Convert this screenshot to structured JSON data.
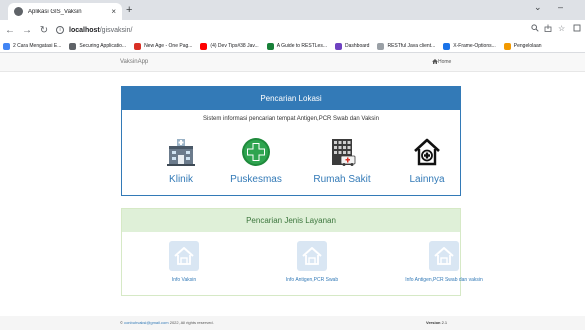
{
  "browser": {
    "tab_title": "Aplikasi GIS_Vaksin",
    "tab_close": "×",
    "new_tab": "+",
    "url_host": "localhost",
    "url_path": "/gisvaksin/",
    "bookmarks": [
      {
        "label": "2 Cara Mengatasi E...",
        "color": "#4285f4"
      },
      {
        "label": "Securing Applicatio...",
        "color": "#5f6368"
      },
      {
        "label": "New Age - One Pag...",
        "color": "#d93025"
      },
      {
        "label": "(4) Dev Tips#38 Jav...",
        "color": "#ff0000"
      },
      {
        "label": "A Guide to RESTLes...",
        "color": "#188038"
      },
      {
        "label": "Dashboard",
        "color": "#6f42c1"
      },
      {
        "label": "RESTful Java client...",
        "color": "#9aa0a6"
      },
      {
        "label": "X-Frame-Options...",
        "color": "#1a73e8"
      },
      {
        "label": "Pengelolaan",
        "color": "#f29900"
      }
    ]
  },
  "nav": {
    "brand": "VaksinApp",
    "home": "Home"
  },
  "lokasi": {
    "heading": "Pencarian Lokasi",
    "subtitle": "Sistem informasi pencarian tempat Antigen,PCR Swab dan Vaksin",
    "items": [
      {
        "label": "Klinik",
        "icon": "hospital-building-icon"
      },
      {
        "label": "Puskesmas",
        "icon": "medical-cross-icon"
      },
      {
        "label": "Rumah Sakit",
        "icon": "hospital-ambulance-icon"
      },
      {
        "label": "Lainnya",
        "icon": "house-medical-icon"
      }
    ]
  },
  "layanan": {
    "heading": "Pencarian Jenis Layanan",
    "items": [
      {
        "label": "Info Vaksin",
        "icon": "home-icon"
      },
      {
        "label": "Info Antigen,PCR Swab",
        "icon": "home-icon"
      },
      {
        "label": "Info Antigen,PCR Swab dan vaksin",
        "icon": "home-icon"
      }
    ]
  },
  "footer": {
    "copyright_prefix": "©",
    "email": "conbuhvaksi@gmail.com",
    "copyright_suffix": "2022, All rights reserved.",
    "version_label": "Version",
    "version_value": "2.1"
  },
  "colors": {
    "primary": "#337ab7",
    "success_bg": "#dff0d8",
    "success_text": "#3c763d",
    "icon_box": "#d9e6f3"
  }
}
